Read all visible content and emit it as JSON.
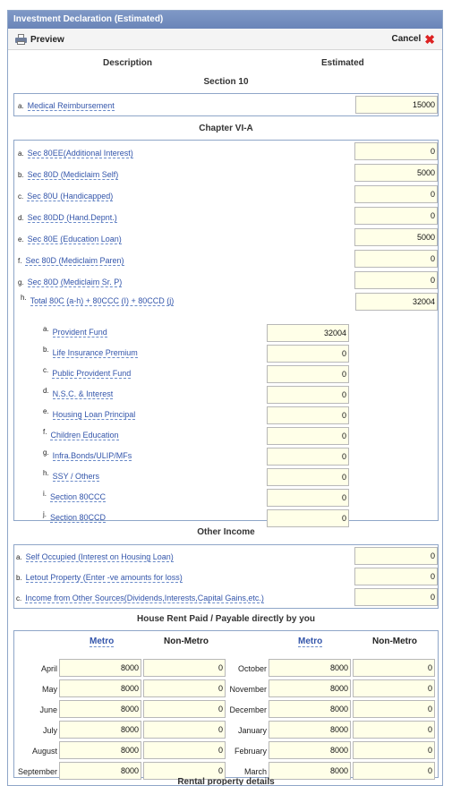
{
  "title": "Investment Declaration (Estimated)",
  "toolbar": {
    "preview_label": "Preview",
    "cancel_label": "Cancel",
    "preview_icon": "printer-icon",
    "cancel_icon": "close-icon"
  },
  "columns": {
    "description": "Description",
    "estimated": "Estimated"
  },
  "section10": {
    "heading": "Section 10",
    "rows": [
      {
        "key": "a.",
        "label": "Medical Reimbursement",
        "value": "15000"
      }
    ]
  },
  "chapter6a": {
    "heading": "Chapter VI-A",
    "rows": [
      {
        "key": "a.",
        "label": "Sec 80EE(Additional Interest)",
        "value": "0"
      },
      {
        "key": "b.",
        "label": "Sec 80D (Mediclaim Self)",
        "value": "5000"
      },
      {
        "key": "c.",
        "label": "Sec 80U (Handicapped)",
        "value": "0"
      },
      {
        "key": "d.",
        "label": "Sec 80DD (Hand.Depnt.)",
        "value": "0"
      },
      {
        "key": "e.",
        "label": "Sec 80E (Education Loan)",
        "value": "5000"
      },
      {
        "key": "f.",
        "label": "Sec 80D (Mediclaim Paren)",
        "value": "0"
      },
      {
        "key": "g.",
        "label": "Sec 80D (Mediclaim Sr. P)",
        "value": "0"
      },
      {
        "key": "h.",
        "label": "Total 80C (a-h) + 80CCC (I) + 80CCD (j)",
        "value": "32004"
      }
    ],
    "subrows": [
      {
        "key": "a.",
        "label": "Provident Fund",
        "value": "32004"
      },
      {
        "key": "b.",
        "label": "Life Insurance Premium",
        "value": "0"
      },
      {
        "key": "c.",
        "label": "Public Provident Fund",
        "value": "0"
      },
      {
        "key": "d.",
        "label": "N.S.C. & Interest",
        "value": "0"
      },
      {
        "key": "e.",
        "label": "Housing Loan Principal",
        "value": "0"
      },
      {
        "key": "f.",
        "label": "Children Education",
        "value": "0"
      },
      {
        "key": "g.",
        "label": "Infra.Bonds/ULIP/MFs",
        "value": "0"
      },
      {
        "key": "h.",
        "label": "SSY / Others",
        "value": "0"
      },
      {
        "key": "i.",
        "label": "Section 80CCC",
        "value": "0"
      },
      {
        "key": "j.",
        "label": "Section 80CCD",
        "value": "0"
      }
    ]
  },
  "other_income": {
    "heading": "Other Income",
    "rows": [
      {
        "key": "a.",
        "label": "Self Occupied (Interest on Housing Loan)",
        "value": "0"
      },
      {
        "key": "b.",
        "label": "Letout Property (Enter -ve amounts for loss)",
        "value": "0"
      },
      {
        "key": "c.",
        "label": "Income from Other Sources(Dividends,Interests,Capital Gains,etc.)",
        "value": "0"
      }
    ]
  },
  "house_rent": {
    "heading": "House Rent Paid / Payable directly by you",
    "metro_label": "Metro",
    "nonmetro_label": "Non-Metro",
    "left": [
      {
        "month": "April",
        "metro": "8000",
        "nonmetro": "0"
      },
      {
        "month": "May",
        "metro": "8000",
        "nonmetro": "0"
      },
      {
        "month": "June",
        "metro": "8000",
        "nonmetro": "0"
      },
      {
        "month": "July",
        "metro": "8000",
        "nonmetro": "0"
      },
      {
        "month": "August",
        "metro": "8000",
        "nonmetro": "0"
      },
      {
        "month": "September",
        "metro": "8000",
        "nonmetro": "0"
      }
    ],
    "right": [
      {
        "month": "October",
        "metro": "8000",
        "nonmetro": "0"
      },
      {
        "month": "November",
        "metro": "8000",
        "nonmetro": "0"
      },
      {
        "month": "December",
        "metro": "8000",
        "nonmetro": "0"
      },
      {
        "month": "January",
        "metro": "8000",
        "nonmetro": "0"
      },
      {
        "month": "February",
        "metro": "8000",
        "nonmetro": "0"
      },
      {
        "month": "March",
        "metro": "8000",
        "nonmetro": "0"
      }
    ]
  },
  "rental": {
    "heading": "Rental property details"
  }
}
